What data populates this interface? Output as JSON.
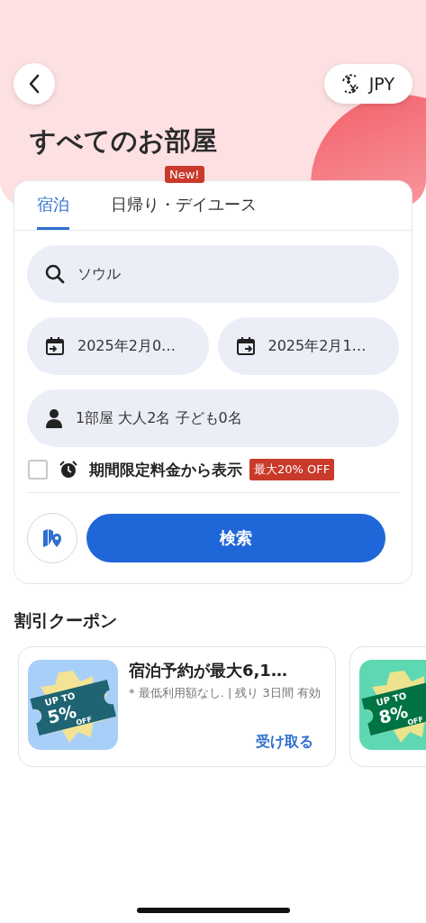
{
  "currency_button": {
    "label": "JPY"
  },
  "title": "すべてのお部屋",
  "tabs": [
    {
      "label": "宿泊",
      "selected": true
    },
    {
      "label": "日帰り・デイユース",
      "selected": false,
      "badge": "New!"
    }
  ],
  "search_field": {
    "value": "ソウル"
  },
  "checkin_field": {
    "value": "2025年2月0…"
  },
  "checkout_field": {
    "value": "2025年2月1…"
  },
  "guests_field": {
    "value": "1部屋 大人2名 子ども0名"
  },
  "limited_offer": {
    "checked": false,
    "label": "期間限定料金から表示",
    "badge": "最大20% OFF"
  },
  "search_button": {
    "label": "検索"
  },
  "coupons": {
    "title": "割引クーポン",
    "items": [
      {
        "title": "宿泊予約が最大6,1…",
        "note": "* 最低利用額なし. | 残り 3日間 有効",
        "action": "受け取る",
        "color": "#a8cff8",
        "ticket": {
          "top": "UP TO",
          "percent": "5%",
          "off": "OFF"
        }
      },
      {
        "color": "#5ed8b2",
        "ticket": {
          "top": "UP TO",
          "percent": "8%",
          "off": "OFF"
        }
      }
    ]
  }
}
